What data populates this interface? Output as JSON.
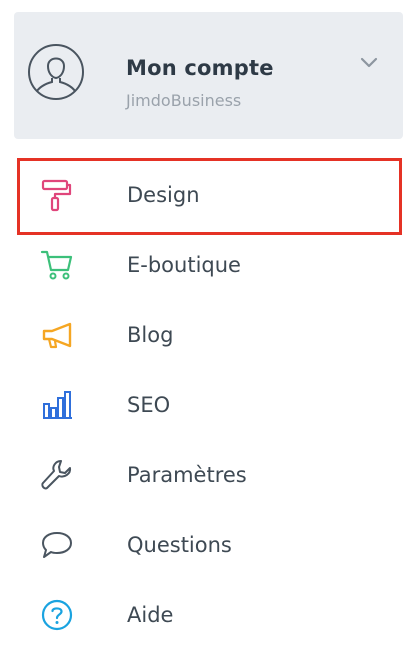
{
  "account": {
    "name": "Mon compte",
    "plan": "JimdoBusiness",
    "avatar_icon": "user-avatar-icon",
    "expand_icon": "chevron-down-icon"
  },
  "menu": {
    "items": [
      {
        "label": "Design",
        "icon": "paint-roller-icon",
        "color": "#e0457b",
        "active": true
      },
      {
        "label": "E-boutique",
        "icon": "shopping-cart-icon",
        "color": "#3cc07a",
        "active": false
      },
      {
        "label": "Blog",
        "icon": "megaphone-icon",
        "color": "#f5a623",
        "active": false
      },
      {
        "label": "SEO",
        "icon": "bar-chart-icon",
        "color": "#2f6fdb",
        "active": false
      },
      {
        "label": "Paramètres",
        "icon": "wrench-icon",
        "color": "#4a5560",
        "active": false
      },
      {
        "label": "Questions",
        "icon": "speech-bubble-icon",
        "color": "#4a5560",
        "active": false
      },
      {
        "label": "Aide",
        "icon": "help-circle-icon",
        "color": "#1aa3e0",
        "active": false
      }
    ]
  },
  "colors": {
    "highlight_border": "#e53225",
    "account_bg": "#eaedf1"
  }
}
